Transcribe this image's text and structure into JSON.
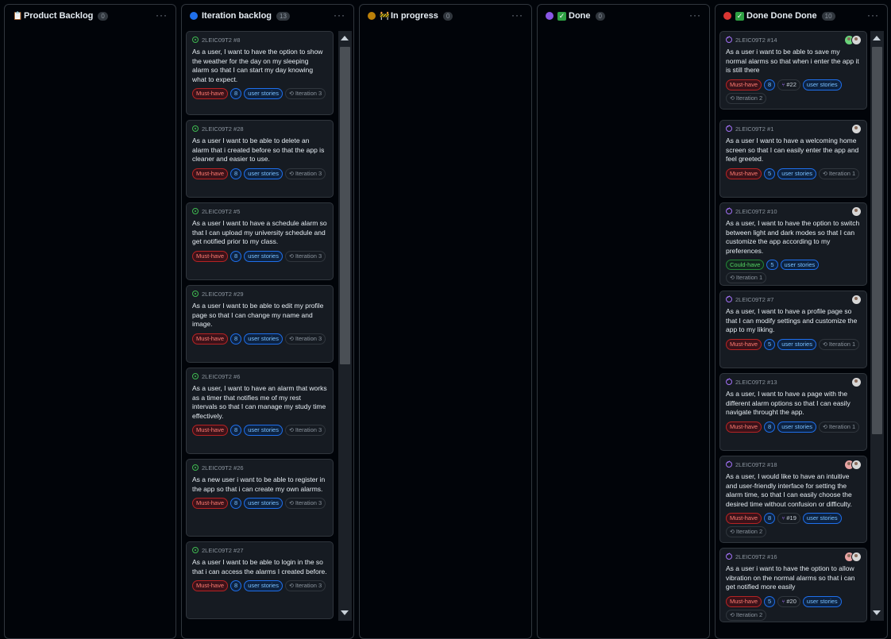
{
  "columns": [
    {
      "title": "Product Backlog",
      "icon": "clipboard-icon",
      "count": "0",
      "cards": []
    },
    {
      "title": "Iteration backlog",
      "dot_color": "#1f6feb",
      "count": "13",
      "cards": [
        {
          "ref": "2LEIC09T2 #8",
          "state": "open",
          "title": "As a user, I want to have the option to show the weather for the day on my sleeping alarm so that I can start my day knowing what to expect.",
          "priority": "Must-have",
          "points": "8",
          "tag": "user stories",
          "iteration": "Iteration 3"
        },
        {
          "ref": "2LEIC09T2 #28",
          "state": "open",
          "title": "As a user I want to be able to delete an alarm that i created before so that the app is cleaner and easier to use.",
          "priority": "Must-have",
          "points": "8",
          "tag": "user stories",
          "iteration": "Iteration 3"
        },
        {
          "ref": "2LEIC09T2 #5",
          "state": "open",
          "title": "As a user I want to have a schedule alarm so that I can upload my university schedule and get notified prior to my class.",
          "priority": "Must-have",
          "points": "8",
          "tag": "user stories",
          "iteration": "Iteration 3"
        },
        {
          "ref": "2LEIC09T2 #29",
          "state": "open",
          "title": "As a user I want to be able to edit my profile page so that I can change my name and image.",
          "priority": "Must-have",
          "points": "8",
          "tag": "user stories",
          "iteration": "Iteration 3"
        },
        {
          "ref": "2LEIC09T2 #6",
          "state": "open",
          "title": "As a user, I want to have an alarm that works as a timer that notifies me of my rest intervals so that I can manage my study time effectively.",
          "priority": "Must-have",
          "points": "8",
          "tag": "user stories",
          "iteration": "Iteration 3"
        },
        {
          "ref": "2LEIC09T2 #26",
          "state": "open",
          "title": "As a new user i want to be able to register in the app so that i can create my own alarms.",
          "priority": "Must-have",
          "points": "8",
          "tag": "user stories",
          "iteration": "Iteration 3"
        },
        {
          "ref": "2LEIC09T2 #27",
          "state": "open",
          "title": "As a user I want to be able to login in the so that i can access the alarms I created before.",
          "priority": "Must-have",
          "points": "8",
          "tag": "user stories",
          "iteration": "Iteration 3"
        }
      ]
    },
    {
      "title": "In progress",
      "dot_color": "#bb8009",
      "icon": "construction-icon",
      "count": "0",
      "cards": []
    },
    {
      "title": "Done",
      "dot_color": "#8957e5",
      "icon": "check-icon",
      "count": "0",
      "cards": []
    },
    {
      "title": "Done Done Done",
      "dot_color": "#da3633",
      "icon": "check-icon",
      "count": "10",
      "cards": [
        {
          "ref": "2LEIC09T2 #14",
          "state": "closed",
          "title": "As a user i want to be able to save my normal alarms so that when i enter the app it is still there",
          "priority": "Must-have",
          "points": "8",
          "pr": "#22",
          "tag": "user stories",
          "iteration": "Iteration 2",
          "avatars": 2
        },
        {
          "ref": "2LEIC09T2 #1",
          "state": "closed",
          "title": "As a user I want to have a welcoming home screen so that I can easily enter the app and feel greeted.",
          "priority": "Must-have",
          "points": "5",
          "tag": "user stories",
          "iteration": "Iteration 1",
          "avatars": 1
        },
        {
          "ref": "2LEIC09T2 #10",
          "state": "closed",
          "title": "As a user, I want to have the option to switch between light and dark modes so that I can customize the app according to my preferences.",
          "priority": "Could-have",
          "points": "5",
          "tag": "user stories",
          "iteration": "Iteration 1",
          "avatars": 1
        },
        {
          "ref": "2LEIC09T2 #7",
          "state": "closed",
          "title": "As a user, I want to have a profile page so that I can modify settings and customize the app to my liking.",
          "priority": "Must-have",
          "points": "5",
          "tag": "user stories",
          "iteration": "Iteration 1",
          "avatars": 1
        },
        {
          "ref": "2LEIC09T2 #13",
          "state": "closed",
          "title": "As a user, I want to have a page with the different alarm options so that I can easily navigate throught the app.",
          "priority": "Must-have",
          "points": "8",
          "tag": "user stories",
          "iteration": "Iteration 1",
          "avatars": 1
        },
        {
          "ref": "2LEIC09T2 #18",
          "state": "closed",
          "title": "As a user, I would like to have an intuitive and user-friendly interface for setting the alarm time, so that I can easily choose the desired time without confusion or difficulty.",
          "priority": "Must-have",
          "points": "8",
          "pr": "#19",
          "tag": "user stories",
          "iteration": "Iteration 2",
          "avatars": 2
        },
        {
          "ref": "2LEIC09T2 #16",
          "state": "closed",
          "title": "As a user i want to have the option to allow vibration on the normal alarms so that i can get notified more easily",
          "priority": "Must-have",
          "points": "5",
          "pr": "#20",
          "tag": "user stories",
          "iteration": "Iteration 2",
          "avatars": 2
        }
      ]
    }
  ]
}
